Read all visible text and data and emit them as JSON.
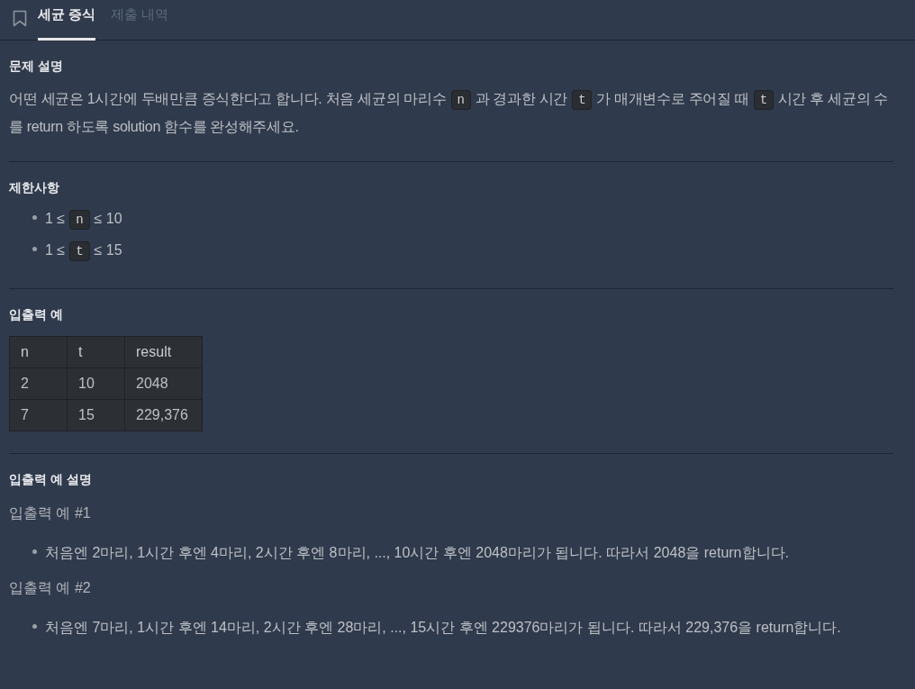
{
  "tabs": [
    {
      "label": "세균 증식",
      "selected": true
    },
    {
      "label": "제출 내역",
      "selected": false
    }
  ],
  "sections": [
    {
      "heading": "문제 설명",
      "blocks": [
        {
          "kind": "paragraph",
          "segments": [
            {
              "kind": "text",
              "text": "어떤 세균은 1시간에 두배만큼 증식한다고 합니다. 처음 세균의 마리수"
            },
            {
              "kind": "code",
              "text": "n"
            },
            {
              "kind": "text",
              "text": "과 경과한 시간"
            },
            {
              "kind": "code",
              "text": "t"
            },
            {
              "kind": "text",
              "text": "가 매개변수로 주어질 때"
            },
            {
              "kind": "code",
              "text": "t"
            },
            {
              "kind": "text",
              "text": "시간 후 세균의 수를 return 하도록 solution 함수를 완성해주세요."
            }
          ]
        }
      ]
    },
    {
      "heading": "제한사항",
      "blocks": [
        {
          "kind": "bullets",
          "items": [
            {
              "segments": [
                {
                  "kind": "text",
                  "text": "1 ≤"
                },
                {
                  "kind": "code",
                  "text": "n"
                },
                {
                  "kind": "text",
                  "text": "≤ 10"
                }
              ]
            },
            {
              "segments": [
                {
                  "kind": "text",
                  "text": "1 ≤"
                },
                {
                  "kind": "code",
                  "text": "t"
                },
                {
                  "kind": "text",
                  "text": "≤ 15"
                }
              ]
            }
          ]
        }
      ]
    },
    {
      "heading": "입출력 예",
      "blocks": [
        {
          "kind": "table",
          "columns": [
            "n",
            "t",
            "result"
          ],
          "rows": [
            [
              "2",
              "10",
              "2048"
            ],
            [
              "7",
              "15",
              "229,376"
            ]
          ]
        }
      ]
    },
    {
      "heading": "입출력 예 설명",
      "blocks": [
        {
          "kind": "subheading",
          "text": "입출력 예 #1"
        },
        {
          "kind": "bullets",
          "items": [
            {
              "segments": [
                {
                  "kind": "text",
                  "text": "처음엔 2마리, 1시간 후엔 4마리, 2시간 후엔 8마리, ..., 10시간 후엔 2048마리가 됩니다. 따라서 2048을 return합니다."
                }
              ]
            }
          ]
        },
        {
          "kind": "subheading",
          "text": "입출력 예 #2"
        },
        {
          "kind": "bullets",
          "items": [
            {
              "segments": [
                {
                  "kind": "text",
                  "text": "처음엔 7마리, 1시간 후엔 14마리, 2시간 후엔 28마리, ..., 15시간 후엔 229376마리가 됩니다. 따라서 229,376을 return합니다."
                }
              ]
            }
          ]
        }
      ]
    }
  ]
}
